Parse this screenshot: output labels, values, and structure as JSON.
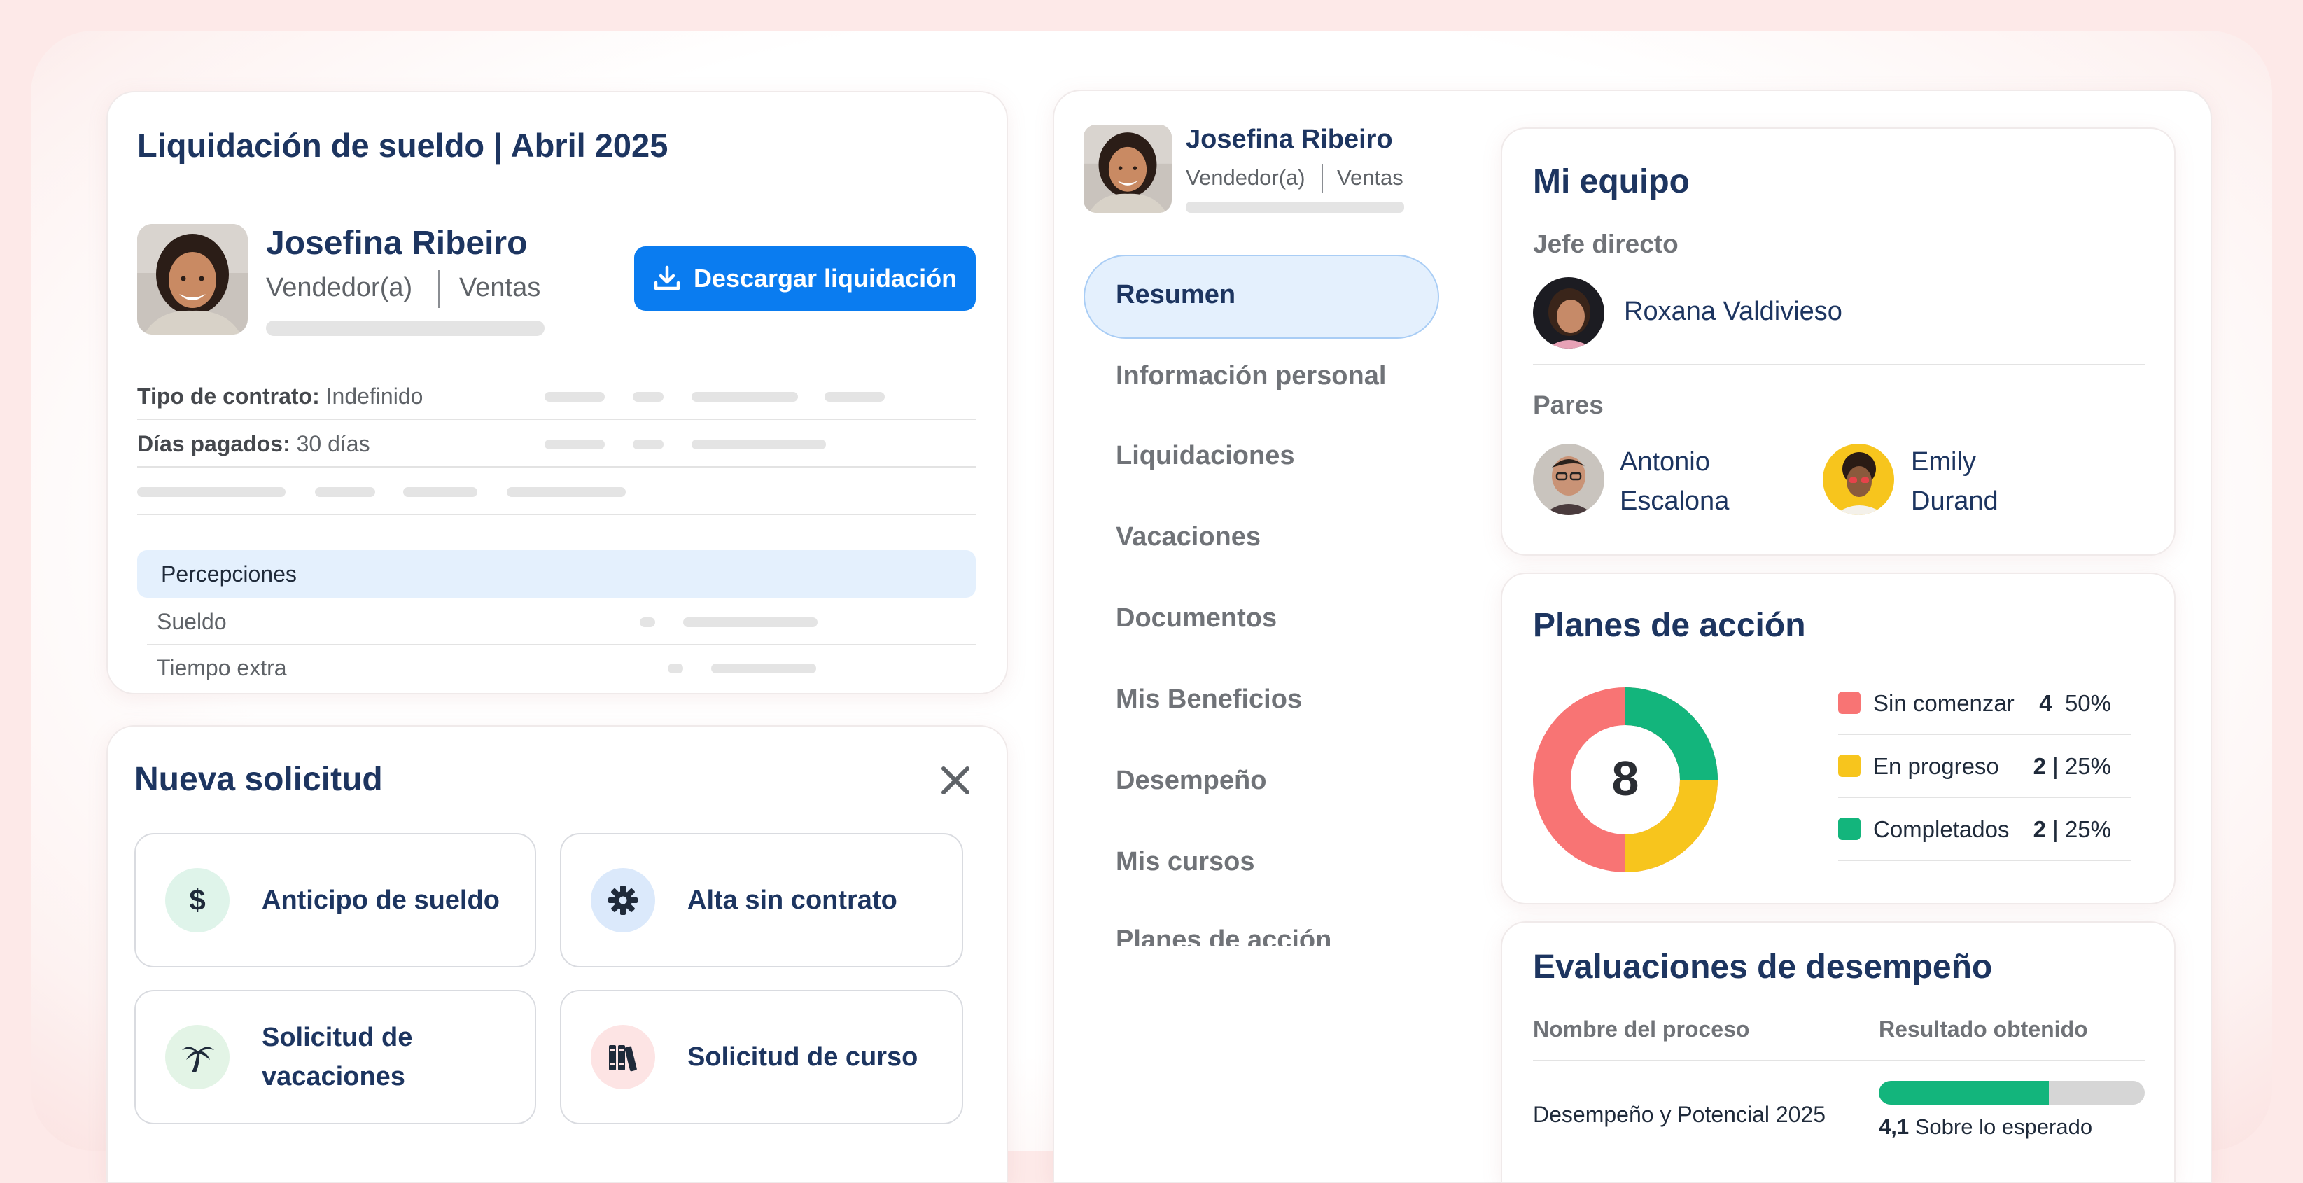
{
  "payslip": {
    "title": "Liquidación de sueldo | Abril 2025",
    "employee_name": "Josefina Ribeiro",
    "role": "Vendedor(a)",
    "department": "Ventas",
    "download_label": "Descargar liquidación",
    "contract_label": "Tipo de contrato:",
    "contract_value": "Indefinido",
    "days_label": "Días pagados:",
    "days_value": "30 días",
    "section_perceptions": "Percepciones",
    "row_salary": "Sueldo",
    "row_overtime": "Tiempo extra"
  },
  "request": {
    "title": "Nueva solicitud",
    "options": [
      {
        "label": "Anticipo de sueldo",
        "icon": "dollar-icon",
        "color": "#dff4ea"
      },
      {
        "label": "Alta sin contrato",
        "icon": "gear-icon",
        "color": "#dbe9fb"
      },
      {
        "label": "Solicitud de vacaciones",
        "icon": "palm-tree-icon",
        "color": "#e3f4e6"
      },
      {
        "label": "Solicitud de curso",
        "icon": "books-icon",
        "color": "#fde4e4"
      }
    ]
  },
  "profile": {
    "name": "Josefina Ribeiro",
    "role": "Vendedor(a)",
    "department": "Ventas"
  },
  "nav": {
    "items": [
      "Resumen",
      "Información personal",
      "Liquidaciones",
      "Vacaciones",
      "Documentos",
      "Mis Beneficios",
      "Desempeño",
      "Mis cursos",
      "Planes de acción"
    ],
    "active": "Resumen"
  },
  "team": {
    "title": "Mi equipo",
    "boss_label": "Jefe directo",
    "boss_name": "Roxana Valdivieso",
    "peers_label": "Pares",
    "peers": [
      {
        "first": "Antonio",
        "last": "Escalona"
      },
      {
        "first": "Emily",
        "last": "Durand"
      }
    ]
  },
  "action_plans": {
    "title": "Planes de acción",
    "total": "8",
    "legend": [
      {
        "name": "Sin comenzar",
        "value": "4",
        "pct": "50%",
        "color": "#f87474"
      },
      {
        "name": "En progreso",
        "value": "2",
        "pct": "25%",
        "color": "#f7c51d"
      },
      {
        "name": "Completados",
        "value": "2",
        "pct": "25%",
        "color": "#13b57c"
      }
    ]
  },
  "evaluations": {
    "title": "Evaluaciones de desempeño",
    "col_process": "Nombre del proceso",
    "col_result": "Resultado obtenido",
    "row_process": "Desempeño y Potencial 2025",
    "row_score": "4,1",
    "row_result_text": "Sobre lo esperado",
    "row_progress": 0.64
  },
  "colors": {
    "primary": "#0a7cf0",
    "navy": "#1d3560",
    "success": "#13b57c"
  }
}
